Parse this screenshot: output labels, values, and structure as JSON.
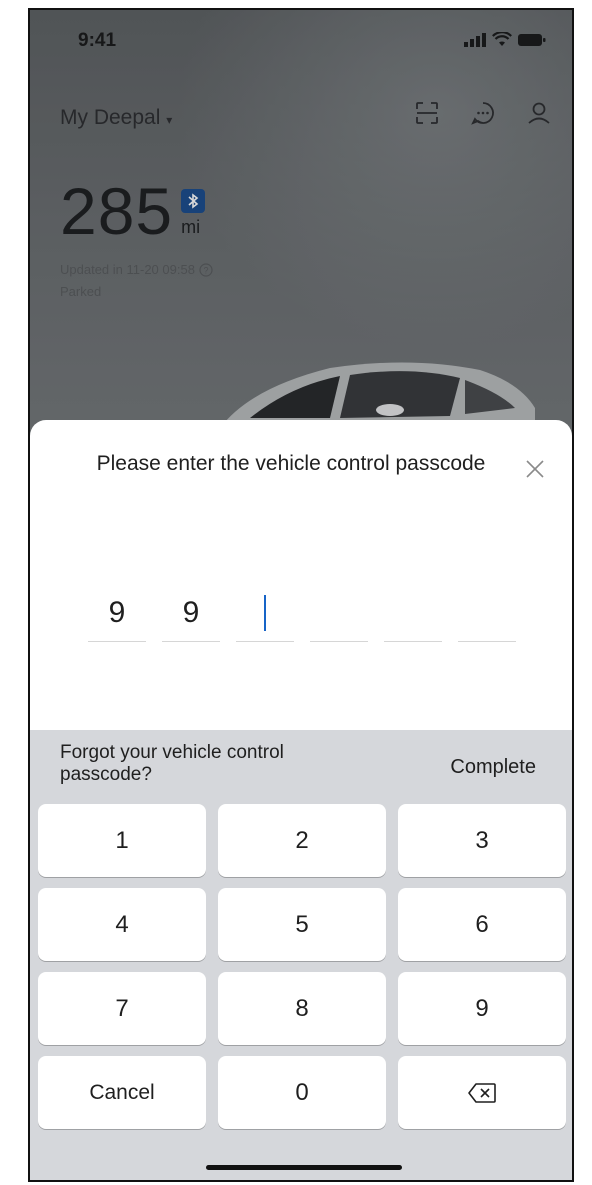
{
  "status_bar": {
    "time": "9:41",
    "icons": [
      "signal-icon",
      "wifi-icon",
      "battery-icon"
    ]
  },
  "app": {
    "car_name": "My Deepal",
    "header_icons": [
      "scan-icon",
      "message-icon",
      "profile-icon"
    ],
    "range_value": "285",
    "range_unit": "mi",
    "updated_text": "Updated in 11-20 09:58",
    "status_text": "Parked"
  },
  "sheet": {
    "title": "Please enter the vehicle control passcode",
    "entered_digits": [
      "9",
      "9",
      "",
      "",
      "",
      ""
    ]
  },
  "keyboard": {
    "forgot_label": "Forgot your vehicle control passcode?",
    "complete_label": "Complete",
    "keys": [
      "1",
      "2",
      "3",
      "4",
      "5",
      "6",
      "7",
      "8",
      "9",
      "Cancel",
      "0",
      ""
    ]
  },
  "colors": {
    "cursor": "#1764c7",
    "keyboard_bg": "#d5d7db",
    "bluetooth_badge": "#1d4e8f"
  }
}
